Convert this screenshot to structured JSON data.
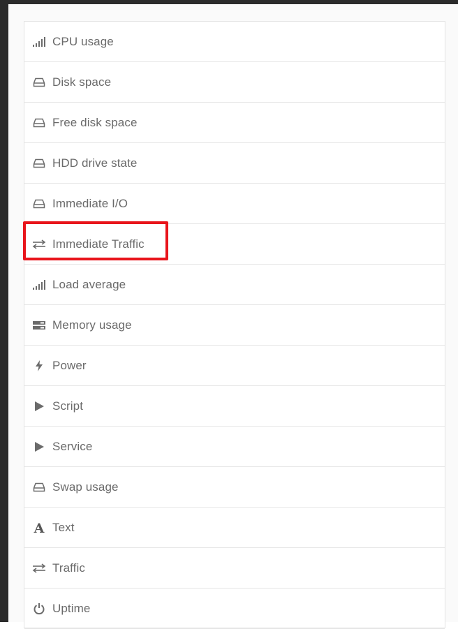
{
  "menu": {
    "items": [
      {
        "label": "CPU usage",
        "icon": "signal-bars-icon"
      },
      {
        "label": "Disk space",
        "icon": "drive-icon"
      },
      {
        "label": "Free disk space",
        "icon": "drive-icon"
      },
      {
        "label": "HDD drive state",
        "icon": "drive-icon"
      },
      {
        "label": "Immediate I/O",
        "icon": "drive-icon"
      },
      {
        "label": "Immediate Traffic",
        "icon": "swap-arrows-icon"
      },
      {
        "label": "Load average",
        "icon": "signal-bars-icon"
      },
      {
        "label": "Memory usage",
        "icon": "memory-icon"
      },
      {
        "label": "Power",
        "icon": "lightning-icon"
      },
      {
        "label": "Script",
        "icon": "play-icon"
      },
      {
        "label": "Service",
        "icon": "play-icon"
      },
      {
        "label": "Swap usage",
        "icon": "drive-icon"
      },
      {
        "label": "Text",
        "icon": "text-icon"
      },
      {
        "label": "Traffic",
        "icon": "swap-arrows-icon"
      },
      {
        "label": "Uptime",
        "icon": "power-icon"
      }
    ]
  },
  "highlight": {
    "target_label": "Immediate Traffic",
    "color": "#e8141b"
  },
  "colors": {
    "text": "#6a6a6a",
    "icon": "#6b6b6b",
    "divider": "#e6e6e6"
  }
}
